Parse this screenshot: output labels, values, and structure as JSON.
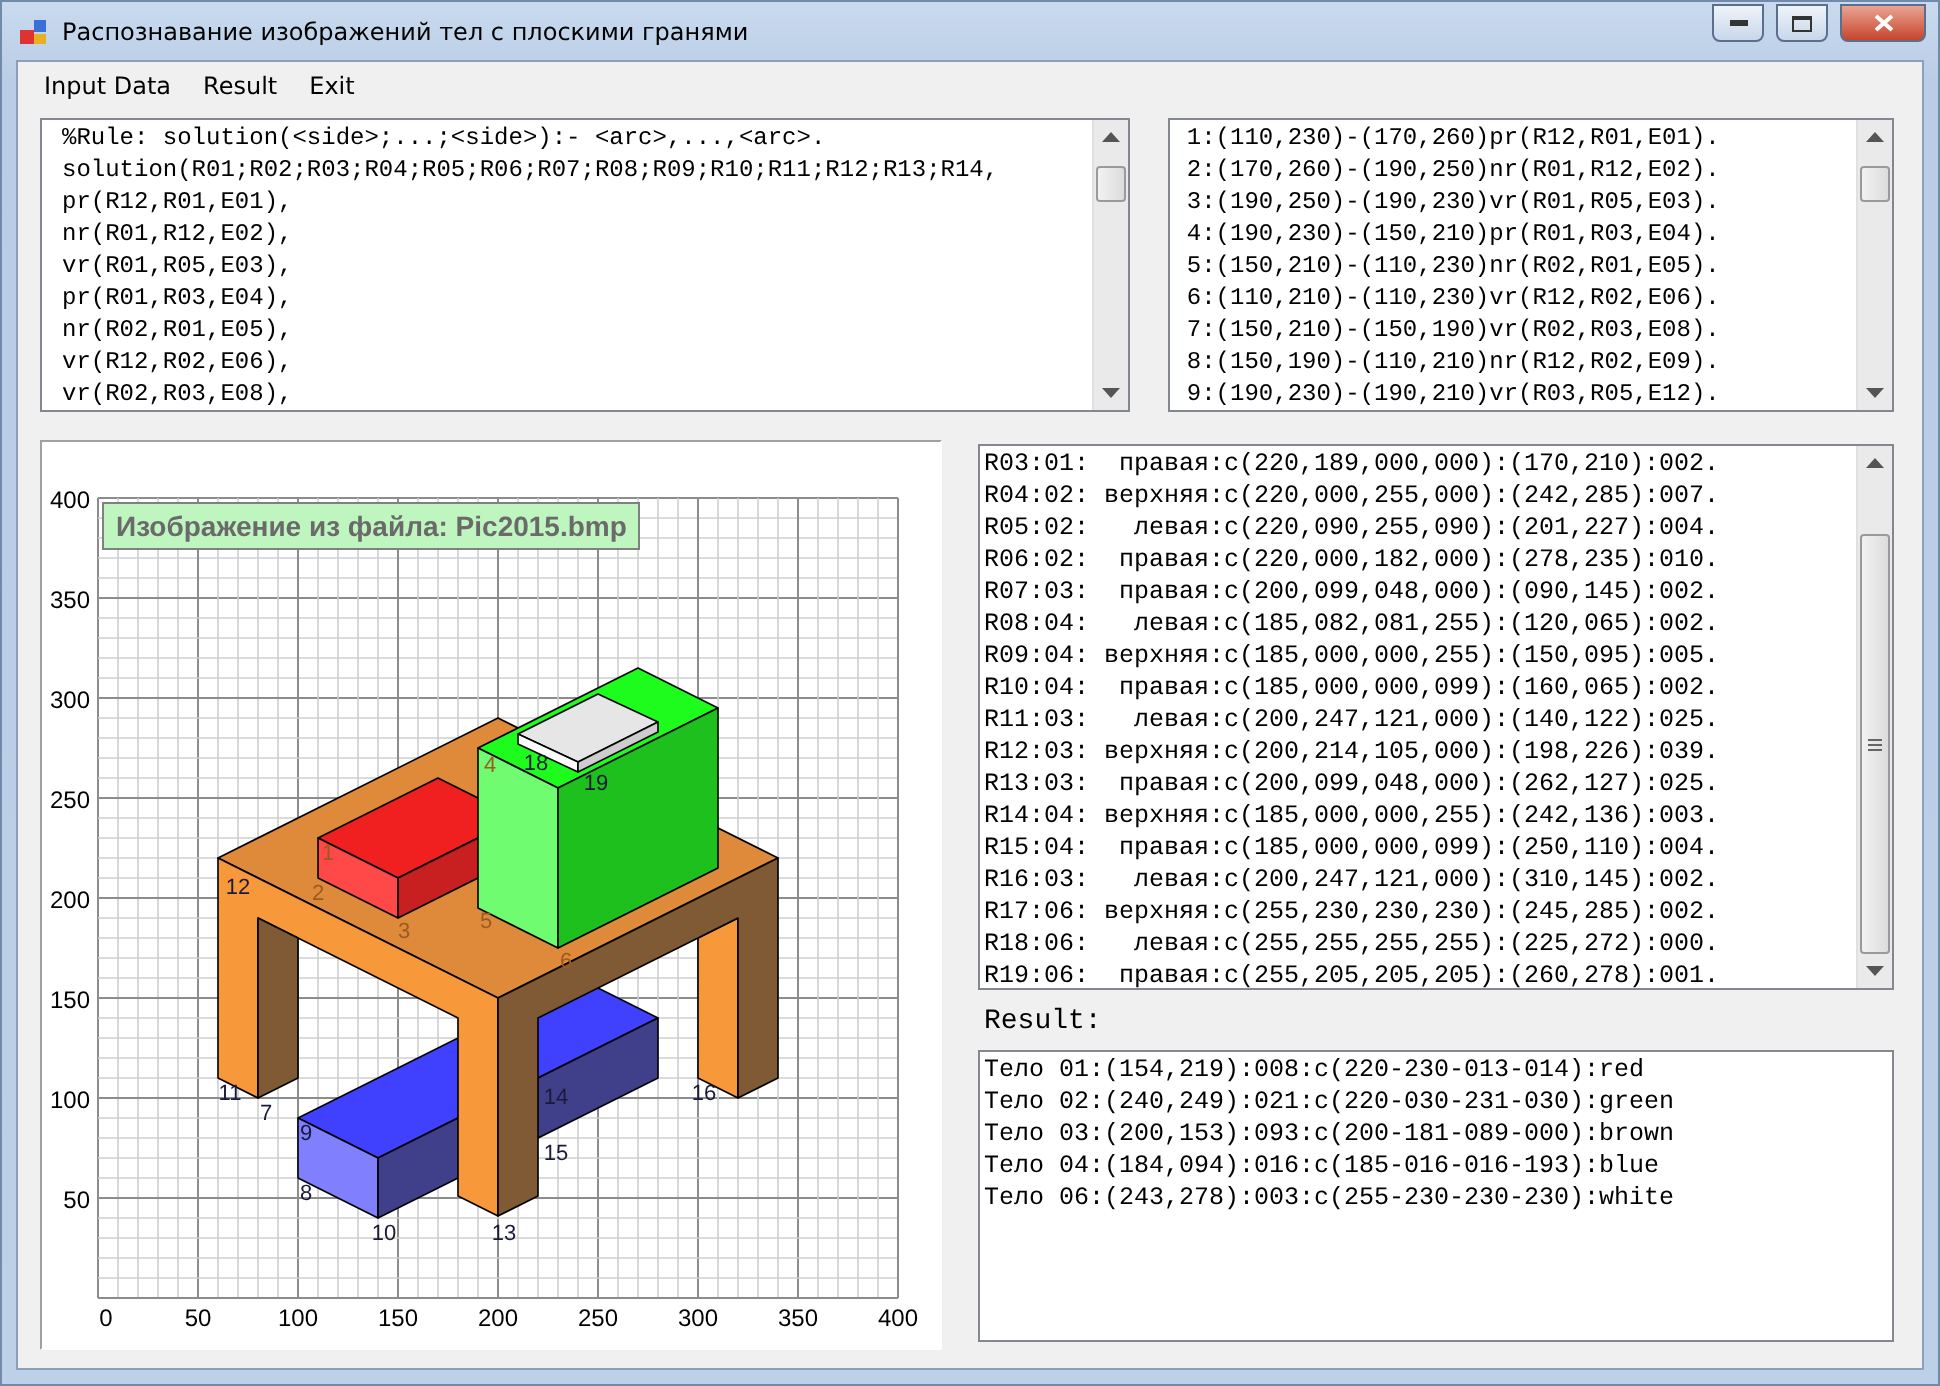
{
  "window": {
    "title": "Распознавание изображений тел с плоскими гранями"
  },
  "menu": [
    "Input Data",
    "Result",
    "Exit"
  ],
  "rules_text": {
    "lines": [
      "%Rule: solution(<side>;...;<side>):- <arc>,...,<arc>.",
      "solution(R01;R02;R03;R04;R05;R06;R07;R08;R09;R10;R11;R12;R13;R14,",
      "pr(R12,R01,E01),",
      "nr(R01,R12,E02),",
      "vr(R01,R05,E03),",
      "pr(R01,R03,E04),",
      "nr(R02,R01,E05),",
      "vr(R12,R02,E06),",
      "vr(R02,R03,E08),"
    ]
  },
  "arcs_list": {
    "lines": [
      "1:(110,230)-(170,260)pr(R12,R01,E01).",
      "2:(170,260)-(190,250)nr(R01,R12,E02).",
      "3:(190,250)-(190,230)vr(R01,R05,E03).",
      "4:(190,230)-(150,210)pr(R01,R03,E04).",
      "5:(150,210)-(110,230)nr(R02,R01,E05).",
      "6:(110,210)-(110,230)vr(R12,R02,E06).",
      "7:(150,210)-(150,190)vr(R02,R03,E08).",
      "8:(150,190)-(110,210)nr(R12,R02,E09).",
      "9:(190,230)-(190,210)vr(R03,R05,E12)."
    ]
  },
  "figure": {
    "caption": "Изображение из файла: Pic2015.bmp",
    "x_ticks": [
      "0",
      "50",
      "100",
      "150",
      "200",
      "250",
      "300",
      "350",
      "400"
    ],
    "y_ticks": [
      "400",
      "350",
      "300",
      "250",
      "200",
      "150",
      "100",
      "50"
    ],
    "vertex_labels": [
      "1",
      "2",
      "3",
      "4",
      "5",
      "6",
      "7",
      "8",
      "9",
      "10",
      "11",
      "12",
      "13",
      "14",
      "15",
      "16",
      "18",
      "19"
    ]
  },
  "regions_list": {
    "lines": [
      "R03:01:  правая:c(220,189,000,000):(170,210):002.",
      "R04:02: верхняя:c(220,000,255,000):(242,285):007.",
      "R05:02:   левая:c(220,090,255,090):(201,227):004.",
      "R06:02:  правая:c(220,000,182,000):(278,235):010.",
      "R07:03:  правая:c(200,099,048,000):(090,145):002.",
      "R08:04:   левая:c(185,082,081,255):(120,065):002.",
      "R09:04: верхняя:c(185,000,000,255):(150,095):005.",
      "R10:04:  правая:c(185,000,000,099):(160,065):002.",
      "R11:03:   левая:c(200,247,121,000):(140,122):025.",
      "R12:03: верхняя:c(200,214,105,000):(198,226):039.",
      "R13:03:  правая:c(200,099,048,000):(262,127):025.",
      "R14:04: верхняя:c(185,000,000,255):(242,136):003.",
      "R15:04:  правая:c(185,000,000,099):(250,110):004.",
      "R16:03:   левая:c(200,247,121,000):(310,145):002.",
      "R17:06: верхняя:c(255,230,230,230):(245,285):002.",
      "R18:06:   левая:c(255,255,255,255):(225,272):000.",
      "R19:06:  правая:c(255,205,205,205):(260,278):001."
    ]
  },
  "result": {
    "label": "Result:",
    "lines": [
      "Тело 01:(154,219):008:c(220-230-013-014):red",
      "Тело 02:(240,249):021:c(220-030-231-030):green",
      "Тело 03:(200,153):093:c(200-181-089-000):brown",
      "Тело 04:(184,094):016:c(185-016-016-193):blue",
      "Тело 06:(243,278):003:c(255-230-230-230):white"
    ]
  }
}
